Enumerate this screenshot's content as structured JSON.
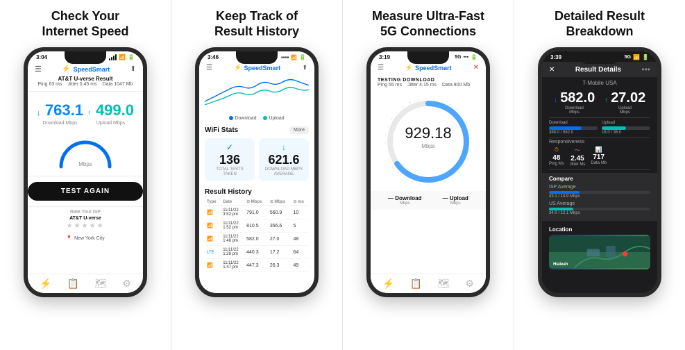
{
  "panels": [
    {
      "id": "panel1",
      "title": "Check Your\nInternet Speed",
      "phone": {
        "statusTime": "3:04",
        "isp": "AT&T U-verse Result",
        "ping": "Ping 63 ms",
        "jitter": "Jitter 0.45 ms",
        "data": "Data 1047 Mb",
        "downloadVal": "763.1",
        "uploadVal": "499.0",
        "downloadLabel": "Download Mbps",
        "uploadLabel": "Upload Mbps",
        "testBtn": "TEST AGAIN",
        "ispLabel": "Rate Your ISP",
        "ispName": "AT&T U-verse",
        "location": "New York City"
      }
    },
    {
      "id": "panel2",
      "title": "Keep Track of\nResult History",
      "phone": {
        "statusTime": "3:46",
        "wifiStats": "WiFi Stats",
        "moreBtn": "More",
        "totalTests": "136",
        "totalTestsLabel": "TOTAL TESTS\nTAKEN",
        "avgDownload": "621.6",
        "avgDownloadLabel": "DOWNLOAD MBPS\nAVERAGE",
        "historyTitle": "Result History",
        "tableHeaders": [
          "Type",
          "Date",
          "Mbps ↓",
          "Mbps ↑",
          "ms"
        ],
        "rows": [
          {
            "type": "wifi",
            "date": "11/11/22\n3:52 pm",
            "down": "791.0",
            "up": "560.9",
            "ms": "10"
          },
          {
            "type": "wifi",
            "date": "11/11/22\n1:52 pm",
            "down": "810.5",
            "up": "356.6",
            "ms": "5"
          },
          {
            "type": "wifi",
            "date": "11/11/22\n1:48 pm",
            "down": "582.0",
            "up": "27.0",
            "ms": "48"
          },
          {
            "type": "lte",
            "date": "11/11/22\n1:28 pm",
            "down": "440.3",
            "up": "17.2",
            "ms": "64"
          },
          {
            "type": "wifi",
            "date": "11/11/22\n1:47 pm",
            "down": "447.3",
            "up": "26.3",
            "ms": "49"
          }
        ]
      }
    },
    {
      "id": "panel3",
      "title": "Measure Ultra-Fast\n5G Connections",
      "phone": {
        "statusTime": "3:19",
        "testingLabel": "TESTING DOWNLOAD",
        "ping": "Ping 55 ms",
        "jitter": "Jitter 4.15 ms",
        "data": "Data 800 Mb",
        "speedVal": "929.18",
        "unit": "Mbps",
        "downloadMetric": "Download\nMbps",
        "uploadMetric": "Upload\nMbps"
      }
    },
    {
      "id": "panel4",
      "title": "Detailed Result\nBreakdown",
      "phone": {
        "statusTime": "3:39",
        "resultTitle": "Result Details",
        "isp": "T-Mobile USA",
        "downloadVal": "582.0",
        "uploadVal": "27.02",
        "downloadLabel": "Download\nMbps",
        "uploadLabel": "Upload\nMbps",
        "downloadBar": {
          "current": "388.0",
          "max": "582.0",
          "percent": 67
        },
        "uploadBar": {
          "current": "18.0",
          "max": "36.0",
          "percent": 50
        },
        "responsiveness": "Responsiveness",
        "ping": {
          "val": "48",
          "label": "Ping Ms"
        },
        "jitter": {
          "val": "2.45",
          "label": "Jitter Ms"
        },
        "dataMb": {
          "val": "717",
          "label": "Data Mb"
        },
        "compareTitle": "Compare",
        "ispAverage": {
          "label": "ISP Average",
          "val": "43.1 / 14.9 Mbps",
          "percent": 30
        },
        "usAverage": {
          "label": "US Average",
          "val": "34.0 / 12.1 Mbps",
          "percent": 24
        },
        "locationTitle": "Location",
        "mapLabel": "Hialeah"
      }
    }
  ]
}
